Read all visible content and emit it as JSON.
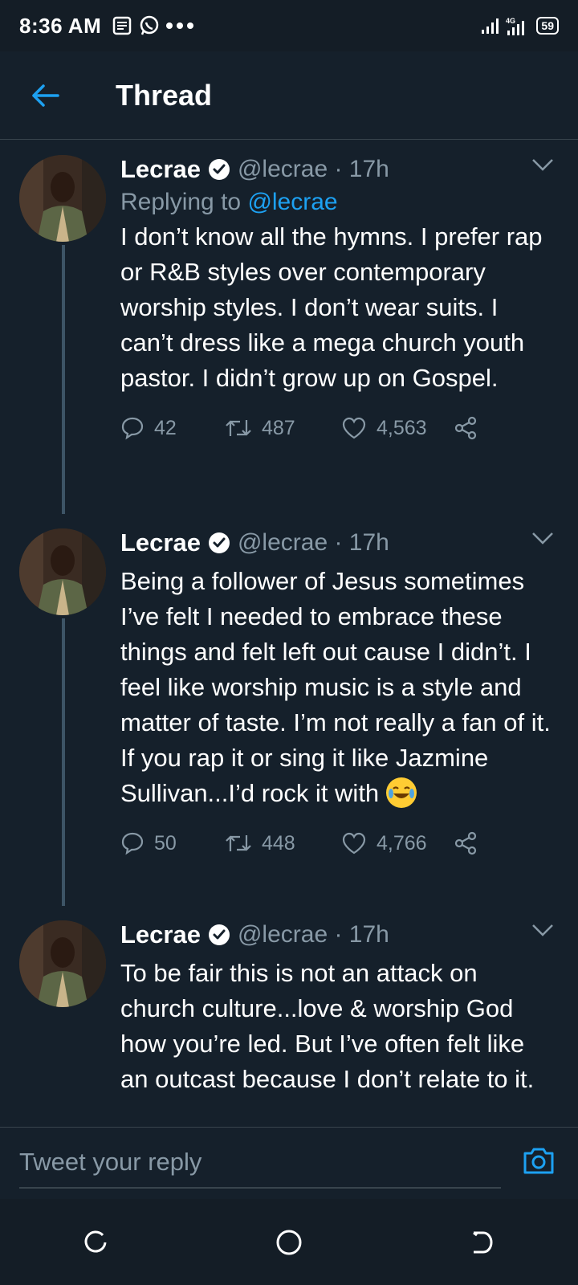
{
  "status_bar": {
    "time": "8:36 AM",
    "battery": "59"
  },
  "header": {
    "title": "Thread"
  },
  "tweets": [
    {
      "name": "Lecrae",
      "meta": "@lecrae · 17h",
      "replying_prefix": "Replying to ",
      "replying_handle": "@lecrae",
      "text": "I don’t know all the hymns. I prefer rap or R&B styles over contemporary worship styles.  I don’t wear suits. I can’t dress like a mega church youth pastor. I didn’t grow up on Gospel.",
      "replies": "42",
      "retweets": "487",
      "likes": "4,563"
    },
    {
      "name": "Lecrae",
      "meta": "@lecrae · 17h",
      "text": "Being a follower of Jesus sometimes I’ve felt I needed to embrace these things and felt left out cause I didn’t. I feel like worship music is a style and matter of taste. I’m not really a fan of it. If you rap it or sing it like Jazmine Sullivan...I’d rock it with",
      "replies": "50",
      "retweets": "448",
      "likes": "4,766"
    },
    {
      "name": "Lecrae",
      "meta": "@lecrae · 17h",
      "text": "To be fair this is not an attack on church culture...love & worship God how you’re led. But I’ve often felt like an outcast because I don’t relate to it."
    }
  ],
  "reply_bar": {
    "placeholder": "Tweet your reply"
  },
  "icons": {
    "verified": "verified-badge-icon",
    "emoji": "face-with-tears-of-joy-emoji"
  },
  "colors": {
    "background": "#15202b",
    "accent": "#1da1f2",
    "muted": "#8899a6"
  }
}
